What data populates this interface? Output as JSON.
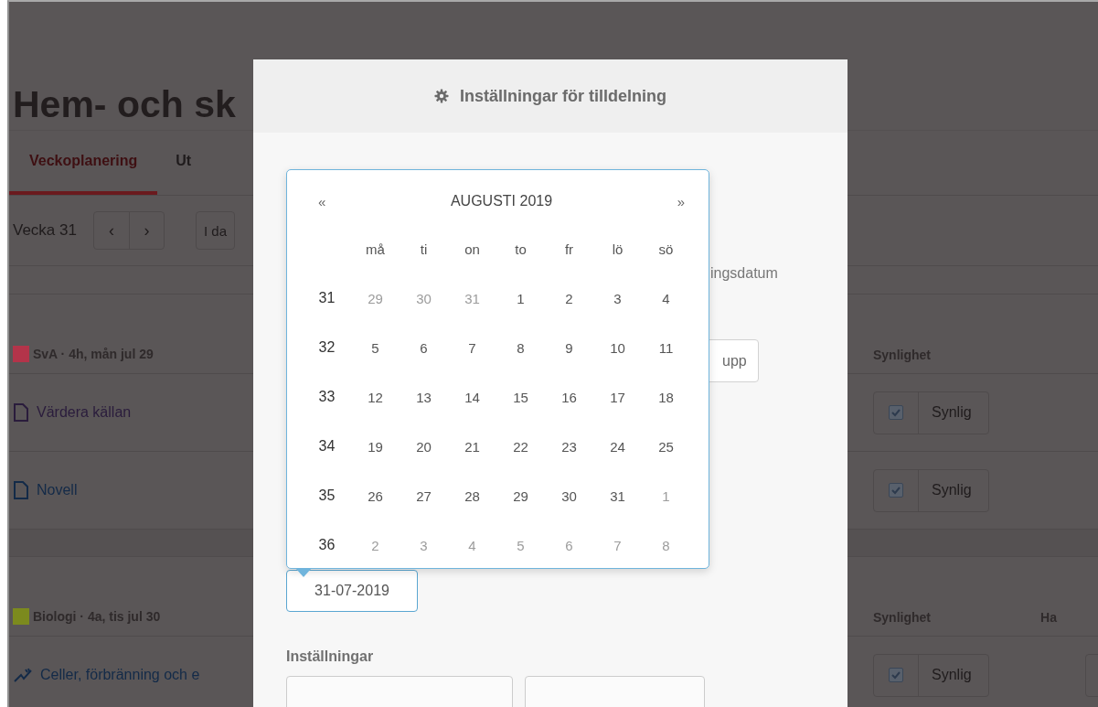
{
  "page": {
    "title": "Hem- och sk",
    "tabs": [
      {
        "label": "Veckoplanering",
        "selected": true
      },
      {
        "label": "Ut",
        "selected": false
      }
    ],
    "toolbar": {
      "week": "Vecka 31",
      "prev": "‹",
      "next": "›",
      "today": "I da"
    },
    "sections": [
      {
        "heading": "SvA · 4h, mån jul 29",
        "color": "#b3344a",
        "column_header": "Synlighet",
        "items": [
          {
            "title": "Värdera källan",
            "kind": "document",
            "visited": true,
            "visibility": {
              "checked": true,
              "label": "Synlig"
            }
          },
          {
            "title": "Novell",
            "kind": "document",
            "visited": false,
            "visibility": {
              "checked": true,
              "label": "Synlig"
            }
          }
        ]
      },
      {
        "heading": "Biologi · 4a, tis jul 30",
        "color": "#7c8a1e",
        "column_header": "Synlighet",
        "extra_header": "Ha",
        "items": [
          {
            "title": "Celler, förbränning och e",
            "kind": "exercise",
            "visited": false,
            "visibility": {
              "checked": true,
              "label": "Synlig"
            }
          }
        ]
      }
    ]
  },
  "modal": {
    "title": "Inställningar för tilldelning",
    "text_end": "ingsdatum",
    "button_end": "upp",
    "datepicker": {
      "prev": "«",
      "title": "AUGUSTI 2019",
      "next": "»",
      "weekdays": [
        "må",
        "ti",
        "on",
        "to",
        "fr",
        "lö",
        "sö"
      ],
      "weeks": [
        {
          "week": "31",
          "days": [
            {
              "d": "29",
              "muted": true
            },
            {
              "d": "30",
              "muted": true
            },
            {
              "d": "31",
              "muted": true
            },
            {
              "d": "1",
              "muted": false
            },
            {
              "d": "2",
              "muted": false
            },
            {
              "d": "3",
              "muted": false
            },
            {
              "d": "4",
              "muted": false
            }
          ]
        },
        {
          "week": "32",
          "days": [
            {
              "d": "5",
              "muted": false
            },
            {
              "d": "6",
              "muted": false
            },
            {
              "d": "7",
              "muted": false
            },
            {
              "d": "8",
              "muted": false
            },
            {
              "d": "9",
              "muted": false
            },
            {
              "d": "10",
              "muted": false
            },
            {
              "d": "11",
              "muted": false
            }
          ]
        },
        {
          "week": "33",
          "days": [
            {
              "d": "12",
              "muted": false
            },
            {
              "d": "13",
              "muted": false
            },
            {
              "d": "14",
              "muted": false
            },
            {
              "d": "15",
              "muted": false
            },
            {
              "d": "16",
              "muted": false
            },
            {
              "d": "17",
              "muted": false
            },
            {
              "d": "18",
              "muted": false
            }
          ]
        },
        {
          "week": "34",
          "days": [
            {
              "d": "19",
              "muted": false
            },
            {
              "d": "20",
              "muted": false
            },
            {
              "d": "21",
              "muted": false
            },
            {
              "d": "22",
              "muted": false
            },
            {
              "d": "23",
              "muted": false
            },
            {
              "d": "24",
              "muted": false
            },
            {
              "d": "25",
              "muted": false
            }
          ]
        },
        {
          "week": "35",
          "days": [
            {
              "d": "26",
              "muted": false
            },
            {
              "d": "27",
              "muted": false
            },
            {
              "d": "28",
              "muted": false
            },
            {
              "d": "29",
              "muted": false
            },
            {
              "d": "30",
              "muted": false
            },
            {
              "d": "31",
              "muted": false
            },
            {
              "d": "1",
              "muted": true
            }
          ]
        },
        {
          "week": "36",
          "days": [
            {
              "d": "2",
              "muted": true
            },
            {
              "d": "3",
              "muted": true
            },
            {
              "d": "4",
              "muted": true
            },
            {
              "d": "5",
              "muted": true
            },
            {
              "d": "6",
              "muted": true
            },
            {
              "d": "7",
              "muted": true
            },
            {
              "d": "8",
              "muted": true
            }
          ]
        }
      ]
    },
    "date_field": {
      "value": "31-07-2019"
    },
    "settings_heading": "Inställningar"
  }
}
